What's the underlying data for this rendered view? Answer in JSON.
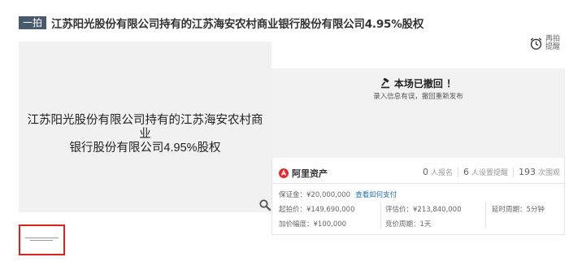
{
  "header": {
    "badge": "一拍",
    "title": "江苏阳光股份有限公司持有的江苏海安农村商业银行股份有限公司4.95%股权"
  },
  "remind": {
    "line1": "再拍",
    "line2": "提醒",
    "icon": "alarm-clock-icon"
  },
  "image": {
    "line1": "江苏阳光股份有限公司持有的江苏海安农村商业",
    "line2": "银行股份有限公司4.95%股权",
    "zoom_icon": "magnifier-icon"
  },
  "withdrawn": {
    "title": "本场已撤回 ！",
    "subtitle": "录入信息有误，撤回重新发布",
    "icon": "gavel-icon"
  },
  "platform": {
    "name": "阿里资产"
  },
  "stats": {
    "registered_count": "0",
    "registered_label": "人报名",
    "reminder_count": "6",
    "reminder_label": "人设置提醒",
    "views_count": "193",
    "views_label": "次围观"
  },
  "details": {
    "deposit_label": "保证金：",
    "deposit_value": "¥20,000,000",
    "payment_link": "查看如何支付",
    "start_price_label": "起拍价：",
    "start_price_value": "¥149,690,000",
    "appraisal_label": "评估价：",
    "appraisal_value": "¥213,840,000",
    "delay_label": "延时周期：",
    "delay_value": "5分钟",
    "increment_label": "加价幅度：",
    "increment_value": "¥100,000",
    "bid_period_label": "竞价周期：",
    "bid_period_value": "1天"
  },
  "colors": {
    "badge_bg": "#4a5a6e",
    "brand_red": "#e6282a",
    "link_blue": "#1f6fb2",
    "thumb_border": "#d9231a"
  }
}
